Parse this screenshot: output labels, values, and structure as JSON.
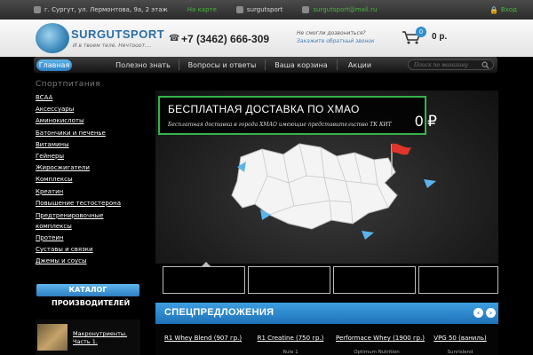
{
  "topbar": {
    "address": "г. Сургут, ул. Лермонтова, 9а, 2 этаж",
    "map_link": "На карте",
    "skype": "surgutsport",
    "email": "surgutsport@mail.ru",
    "login": "Вход"
  },
  "header": {
    "logo_title": "SURGUTSPORT",
    "logo_slogan": "И в твоем теле. Нечтооот....",
    "phone": "+7 (3462) 666-309",
    "callback_question": "Не смогли дозвониться?",
    "callback_link": "Закажите обратный звонок",
    "cart_count": "0",
    "cart_total": "0 р."
  },
  "nav": {
    "tabs": [
      {
        "label": "Главная",
        "active": true
      },
      {
        "label": "Полезно знать"
      },
      {
        "label": "Вопросы и ответы"
      },
      {
        "label": "Ваша корзина"
      },
      {
        "label": "Акции"
      }
    ],
    "search_placeholder": "Поиск по магазину"
  },
  "sidebar": {
    "title": "Спортпитания",
    "items": [
      "BCAA",
      "Аксессуары",
      "Аминокислоты",
      "Батончики и печенье",
      "Витамины",
      "Гейнеры",
      "Жиросжигатели",
      "Комплексы",
      "Креатин",
      "Повышение тестостерона",
      "Предтренировочные комплексы",
      "Протеин",
      "Суставы и связки",
      "Джемы и соусы"
    ],
    "catalog_button": "КАТАЛОГ",
    "manufacturers_title": "ПРОИЗВОДИТЕЛЕЙ",
    "manufacturers_sub": "",
    "journal_title": "",
    "journal_item": "Макронутриенты. Часть 1."
  },
  "hero": {
    "title": "БЕСПЛАТНАЯ ДОСТАВКА ПО ХМАО",
    "subtitle": "Бесплатная доставка в города ХМАО имеющие представительство ТК КИТ",
    "price": "0 ₽"
  },
  "special": {
    "title": "СПЕЦПРЕДЛОЖЕНИЯ",
    "prev_icon": "chevron-left-icon",
    "next_icon": "chevron-right-icon",
    "products": [
      {
        "name": "R1 Whey Blend (907 гр.)",
        "brand": ""
      },
      {
        "name": "R1 Creatine (750 гр.)",
        "brand": "Rule 1"
      },
      {
        "name": "Performace Whey (1900 гр.)",
        "brand": "Optimum Nutrition"
      },
      {
        "name": "VPG 50 (ваниль)",
        "brand": "Sunrislend"
      }
    ]
  },
  "colors": {
    "accent_blue": "#2f8fd0",
    "accent_green": "#36b34a",
    "map_fill": "#ffffff",
    "flag_red": "#e0352b"
  }
}
